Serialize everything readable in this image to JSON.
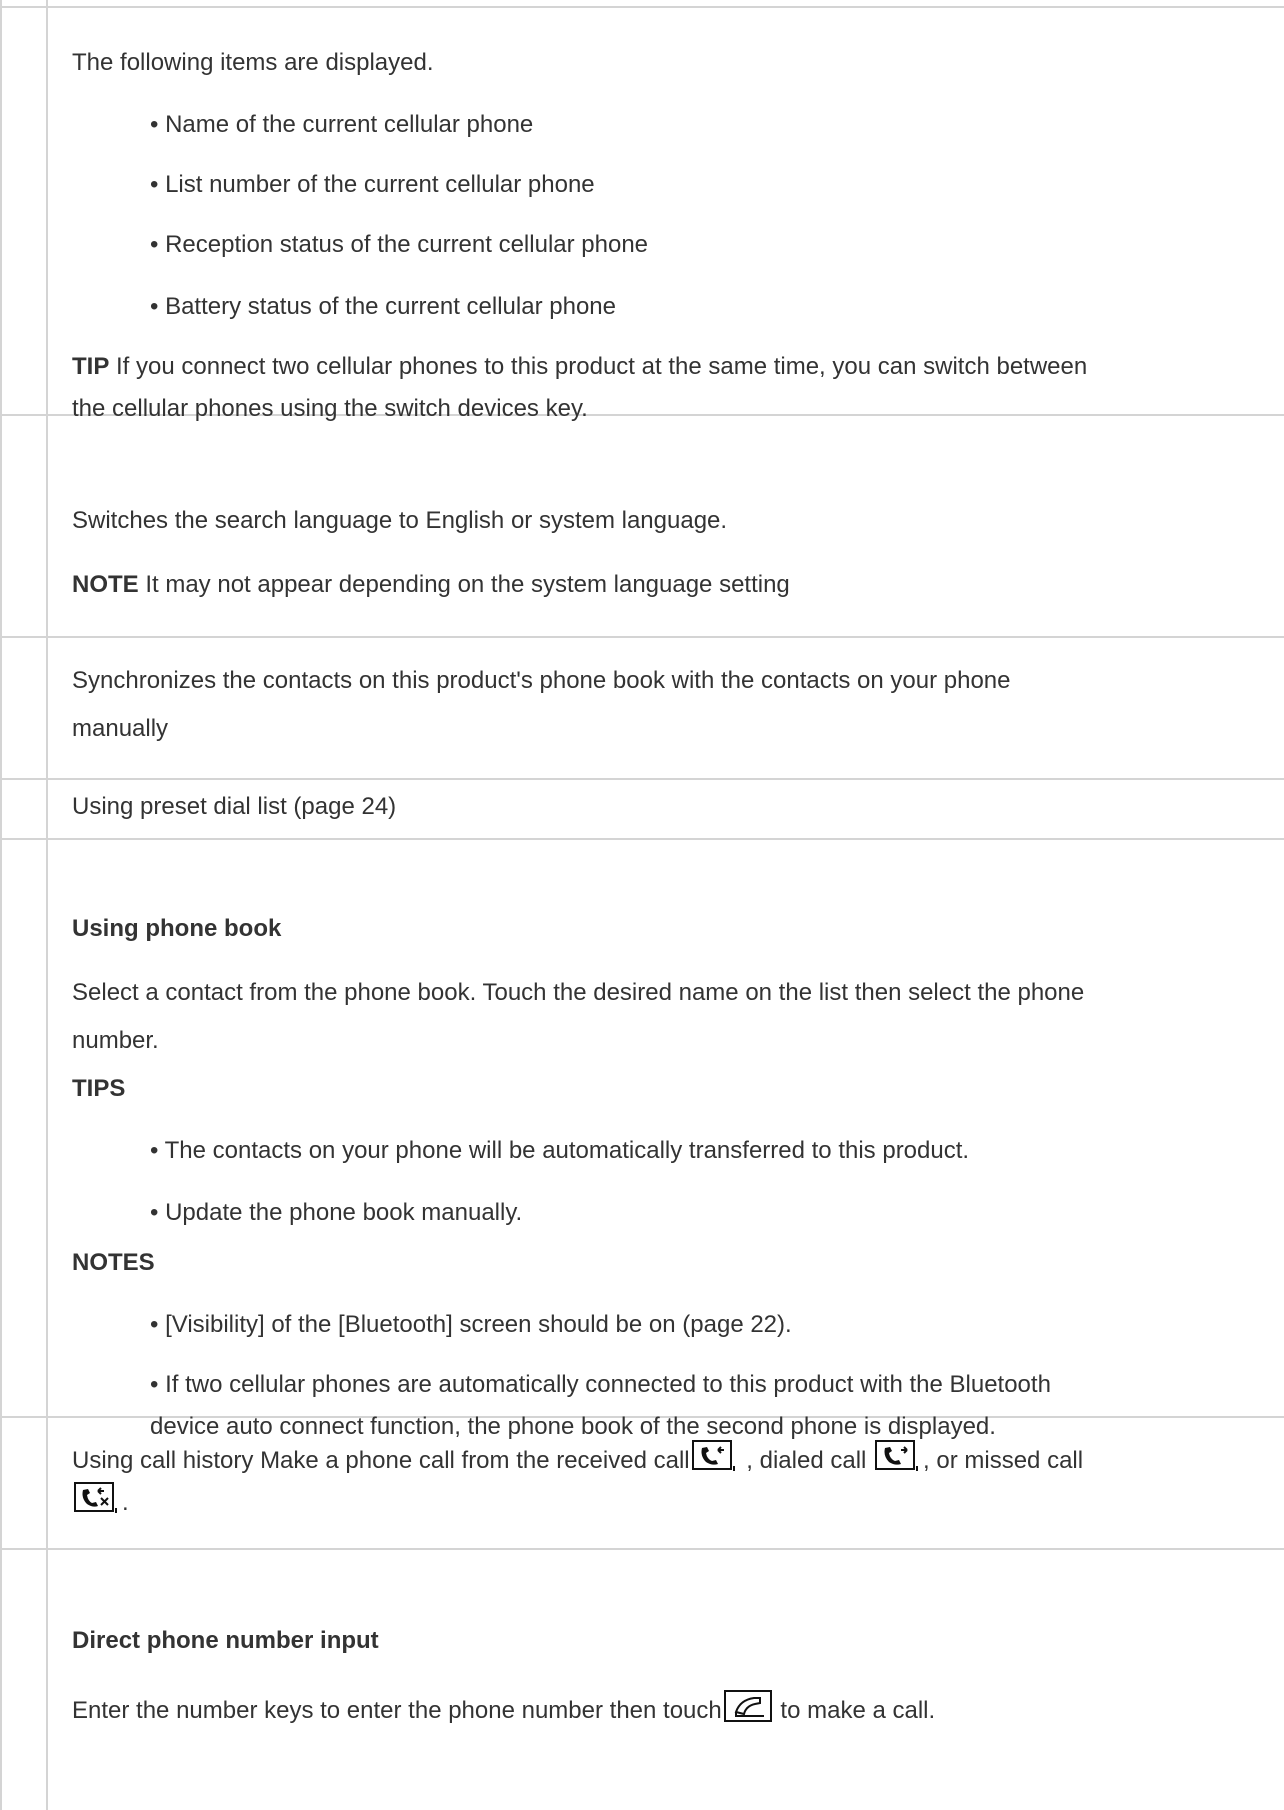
{
  "row1": {
    "intro": "The following items are displayed.",
    "items": [
      "• Name of the current cellular phone",
      "• List number of the current cellular phone",
      "• Reception status of the current cellular phone",
      "• Battery status of the current cellular phone"
    ],
    "tip_label": "TIP",
    "tip_text_1": " If you connect two cellular phones to this product at the same time, you can switch between",
    "tip_text_2": "the cellular phones using the switch devices key."
  },
  "row2": {
    "text": "Switches the search language to English or system language.",
    "note_label": "NOTE",
    "note_text": " It may not appear depending on the system language setting"
  },
  "row3": {
    "line1": "Synchronizes the contacts on this product's phone book with the contacts on your phone",
    "line2": "manually"
  },
  "row4": {
    "text": "Using preset dial list (page 24)"
  },
  "row5": {
    "heading": "Using phone book",
    "line1": "Select a contact from the phone book. Touch the desired name on the list then select the phone",
    "line2": "number.",
    "tips_label": "TIPS",
    "tips": [
      "• The contacts on your phone will be automatically transferred to this product.",
      "• Update the phone book manually."
    ],
    "notes_label": "NOTES",
    "note1": "• [Visibility] of the [Bluetooth] screen should be on (page 22).",
    "note2_line1": "• If two cellular phones are automatically connected to this product with the Bluetooth",
    "note2_line2": "device auto connect function, the phone book of the second phone is displayed."
  },
  "row6": {
    "part1": "Using call history Make a phone call from the received call",
    "part2": " , dialed call ",
    "part3": ", or missed call",
    "part4": "."
  },
  "row7": {
    "heading": "Direct phone number input",
    "part1": "Enter the number keys to enter the phone number then touch",
    "part2": " to make a call."
  }
}
